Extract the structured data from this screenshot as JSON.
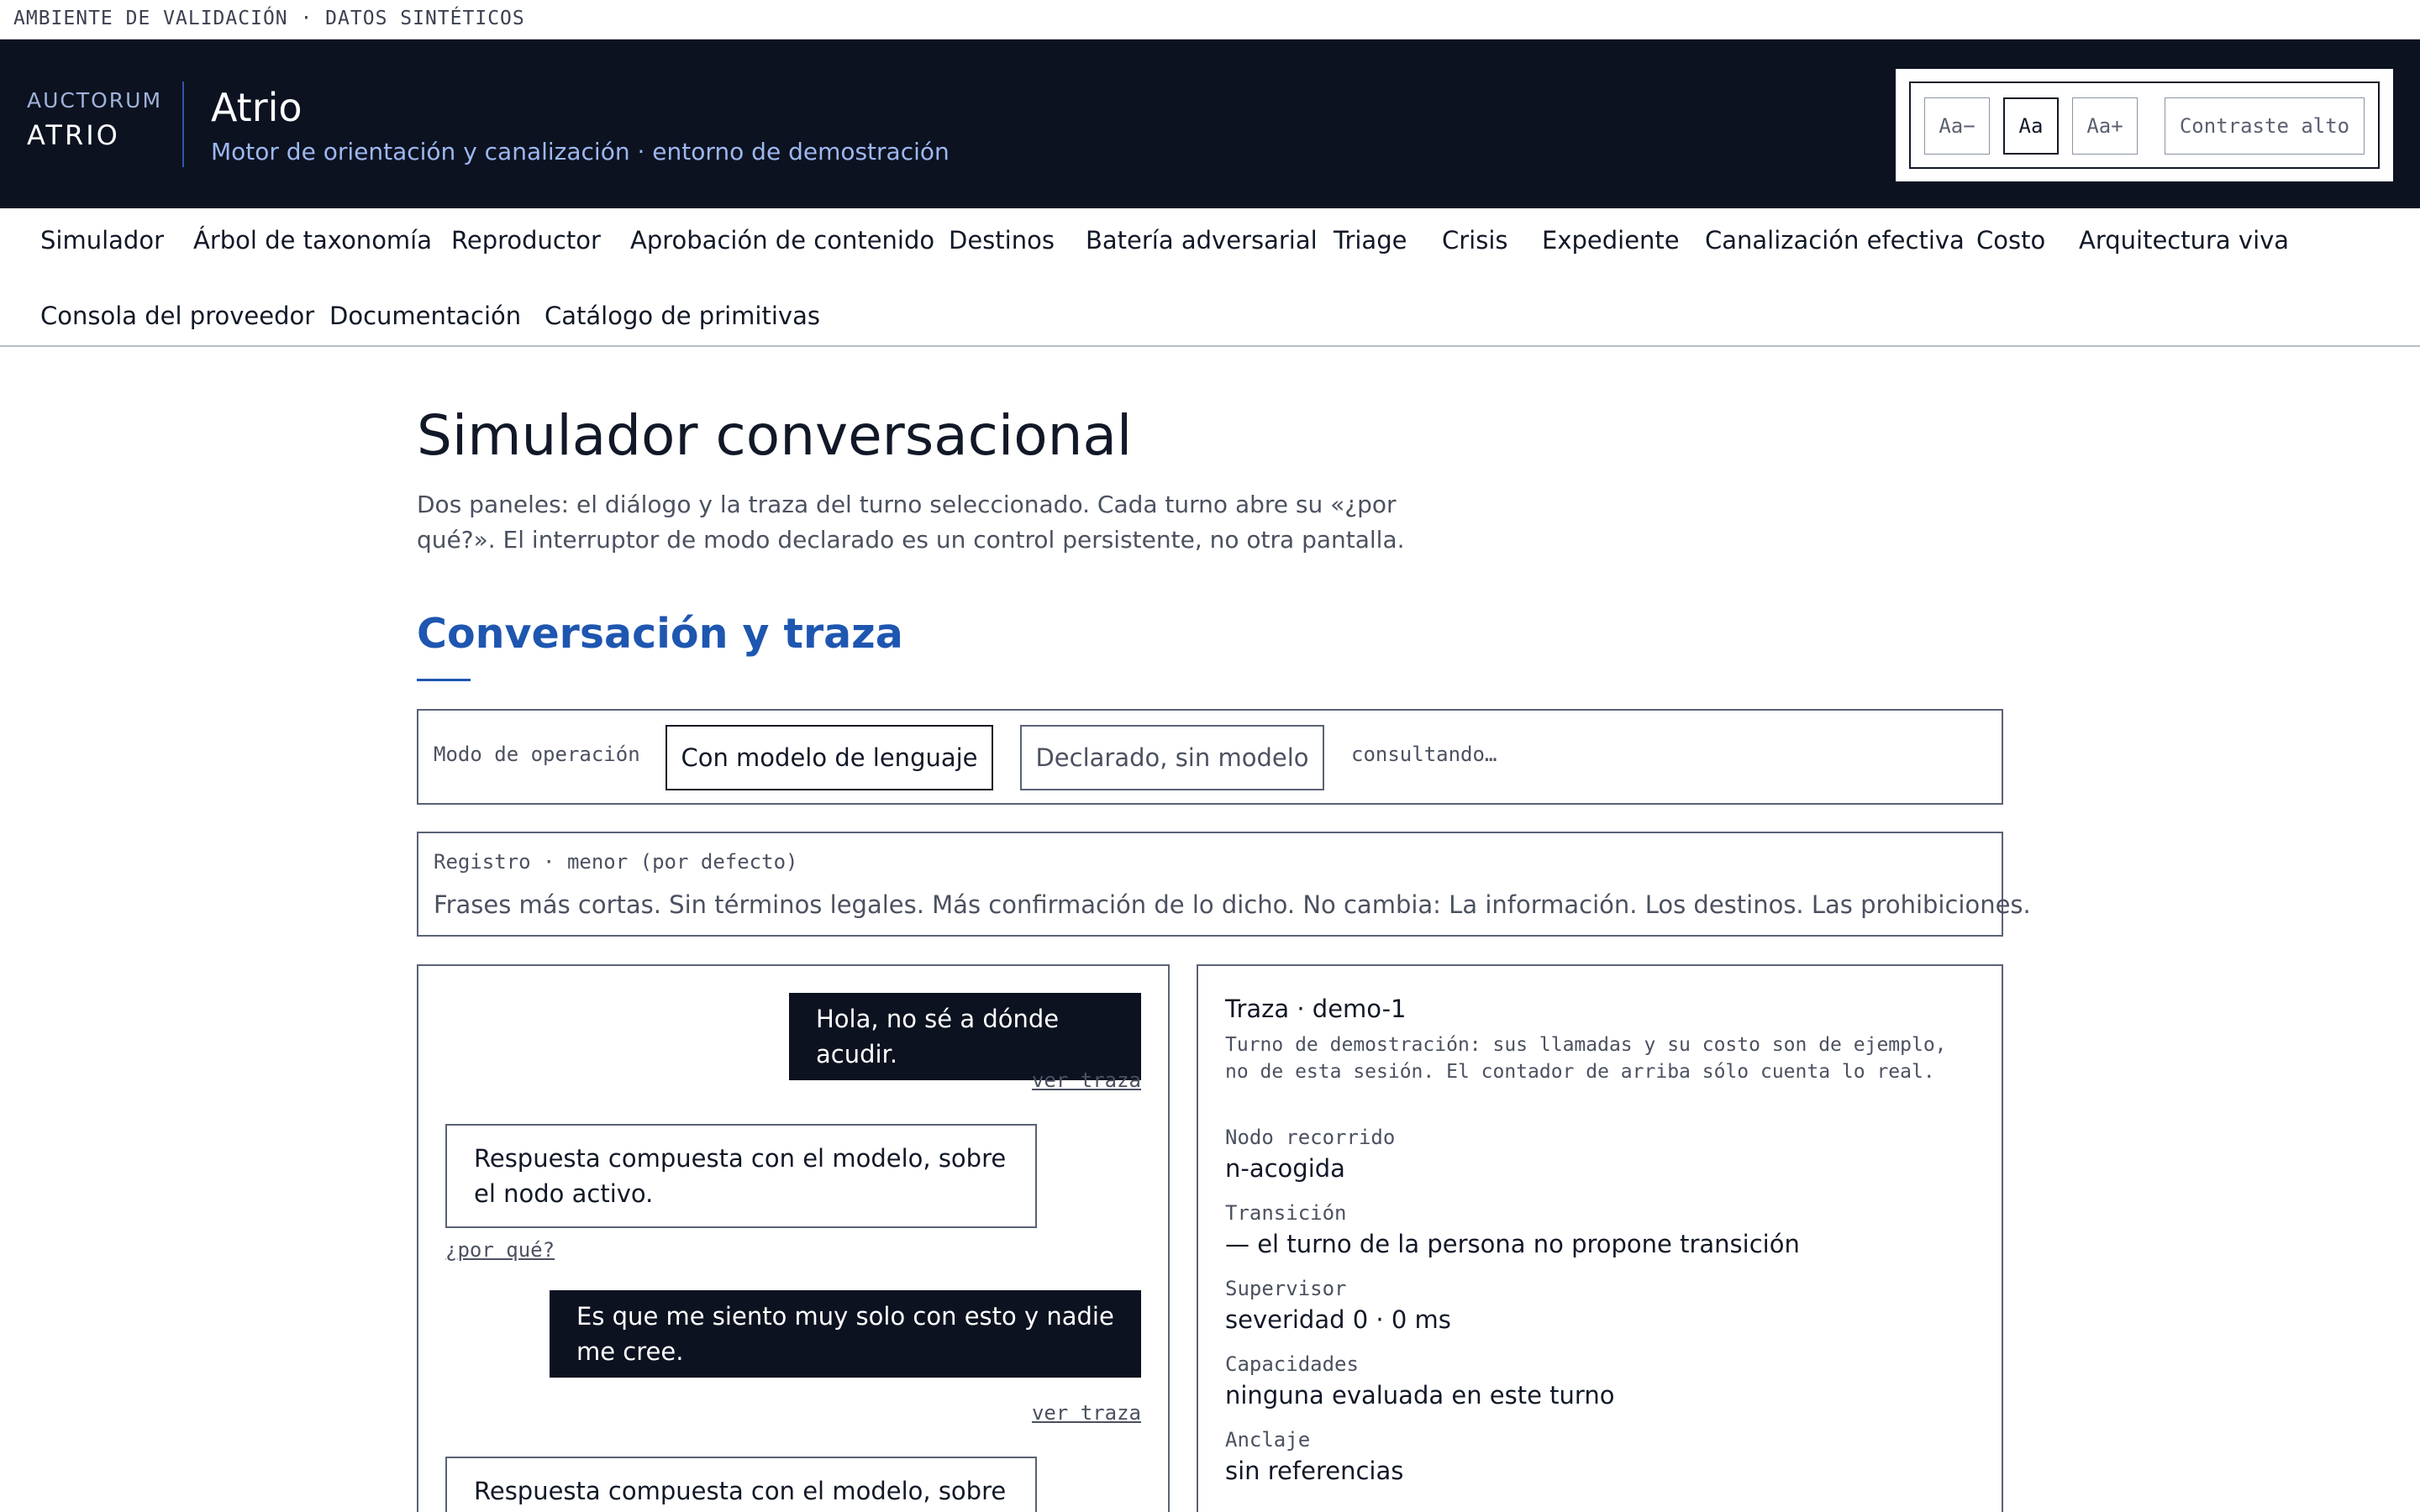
{
  "environment_banner": "AMBIENTE DE VALIDACIÓN · DATOS SINTÉTICOS",
  "header": {
    "brand_small": "AUCTORUM",
    "brand_big": "ATRIO",
    "title": "Atrio",
    "subtitle": "Motor de orientación y canalización · entorno de demostración",
    "a11y": {
      "decrease": "Aa−",
      "normal": "Aa",
      "increase": "Aa+",
      "contrast": "Contraste alto",
      "active": "normal"
    }
  },
  "nav": {
    "items": [
      "Simulador",
      "Árbol de taxonomía",
      "Reproductor",
      "Aprobación de contenido",
      "Destinos",
      "Batería adversarial",
      "Triage",
      "Crisis",
      "Expediente",
      "Canalización efectiva",
      "Costo",
      "Arquitectura viva",
      "Consola del proveedor",
      "Documentación",
      "Catálogo de primitivas"
    ]
  },
  "main": {
    "title": "Simulador conversacional",
    "description": "Dos paneles: el diálogo y la traza del turno seleccionado. Cada turno abre su «¿por qué?». El interruptor de modo declarado es un control persistente, no otra pantalla.",
    "section_title": "Conversación y traza",
    "mode": {
      "label": "Modo de operación",
      "option_model": "Con modelo de lenguaje",
      "option_declared": "Declarado, sin modelo",
      "selected": "Con modelo de lenguaje",
      "status": "consultando…"
    },
    "register": {
      "heading": "Registro · menor (por defecto)",
      "body": "Frases más cortas. Sin términos legales. Más confirmación de lo dicho. No cambia: La información. Los destinos. Las prohibiciones."
    },
    "chat": {
      "user_1": "Hola, no sé a dónde acudir.",
      "trace_link_1": "ver traza",
      "bot_1": "Respuesta compuesta con el modelo, sobre el nodo activo.",
      "why_link_1": "¿por qué?",
      "user_2": "Es que me siento muy solo con esto y nadie me cree.",
      "trace_link_2": "ver traza",
      "bot_2": "Respuesta compuesta con el modelo, sobre el"
    },
    "trace": {
      "title": "Traza · demo-1",
      "note": "Turno de demostración: sus llamadas y su costo son de ejemplo, no de esta sesión. El contador de arriba sólo cuenta lo real.",
      "fields": [
        {
          "label": "Nodo recorrido",
          "value": "n-acogida"
        },
        {
          "label": "Transición",
          "value": "— el turno de la persona no propone transición"
        },
        {
          "label": "Supervisor",
          "value": "severidad 0 · 0 ms"
        },
        {
          "label": "Capacidades",
          "value": "ninguna evaluada en este turno"
        },
        {
          "label": "Anclaje",
          "value": "sin referencias"
        }
      ]
    }
  },
  "colors": {
    "header_bg": "#0c1220",
    "accent_blue": "#1e56b0",
    "subtitle_blue": "#9db8f0"
  }
}
